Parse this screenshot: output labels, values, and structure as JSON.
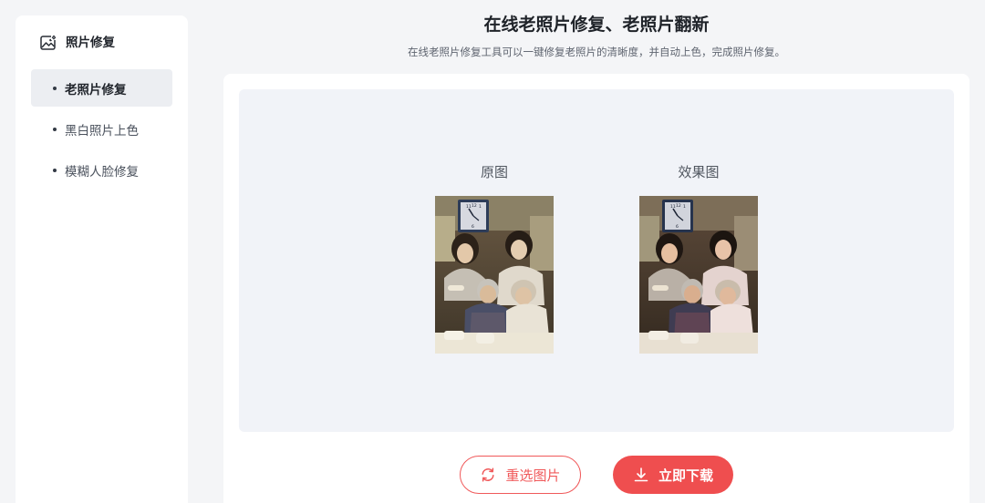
{
  "sidebar": {
    "title": "照片修复",
    "items": [
      {
        "label": "老照片修复",
        "active": true
      },
      {
        "label": "黑白照片上色",
        "active": false
      },
      {
        "label": "模糊人脸修复",
        "active": false
      }
    ]
  },
  "header": {
    "title": "在线老照片修复、老照片翻新",
    "subtitle": "在线老照片修复工具可以一键修复老照片的清晰度，并自动上色，完成照片修复。"
  },
  "preview": {
    "original_label": "原图",
    "result_label": "效果图",
    "clock_numbers": [
      "11",
      "12",
      "1"
    ],
    "clock_bottom_number": "6"
  },
  "actions": {
    "reselect_label": "重选图片",
    "download_label": "立即下载"
  },
  "colors": {
    "accent": "#ef4e4f",
    "background": "#f4f5f7",
    "preview_bg": "#f1f3f8",
    "active_item_bg": "#eceef2"
  },
  "icons": {
    "sidebar_header": "image-repair-icon",
    "reselect": "refresh-icon",
    "download": "download-icon"
  }
}
